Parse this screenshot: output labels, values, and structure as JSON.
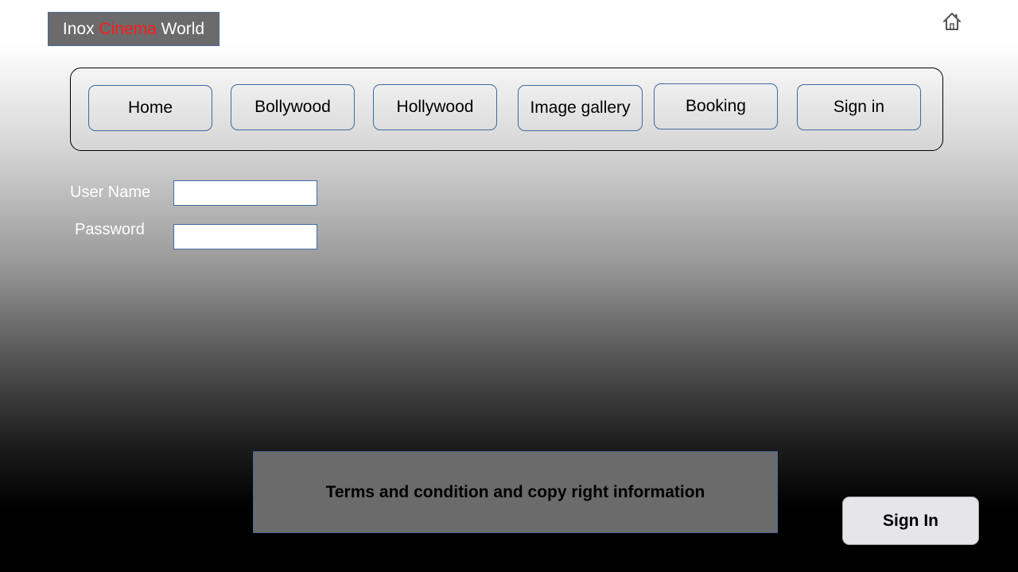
{
  "logo": {
    "part1": "Inox ",
    "part2": "Cinema",
    "part3": " World",
    "accent_color": "#ff1a1a"
  },
  "header": {
    "home_icon": "home-icon"
  },
  "nav": {
    "items": [
      {
        "label": "Home"
      },
      {
        "label": "Bollywood"
      },
      {
        "label": "Hollywood"
      },
      {
        "label": "Image gallery"
      },
      {
        "label": "Booking"
      },
      {
        "label": "Sign in"
      }
    ]
  },
  "form": {
    "username_label": "User Name",
    "username_value": "",
    "password_label": "Password",
    "password_value": ""
  },
  "footer": {
    "text": "Terms and condition and copy right information"
  },
  "actions": {
    "signin_label": "Sign In"
  }
}
